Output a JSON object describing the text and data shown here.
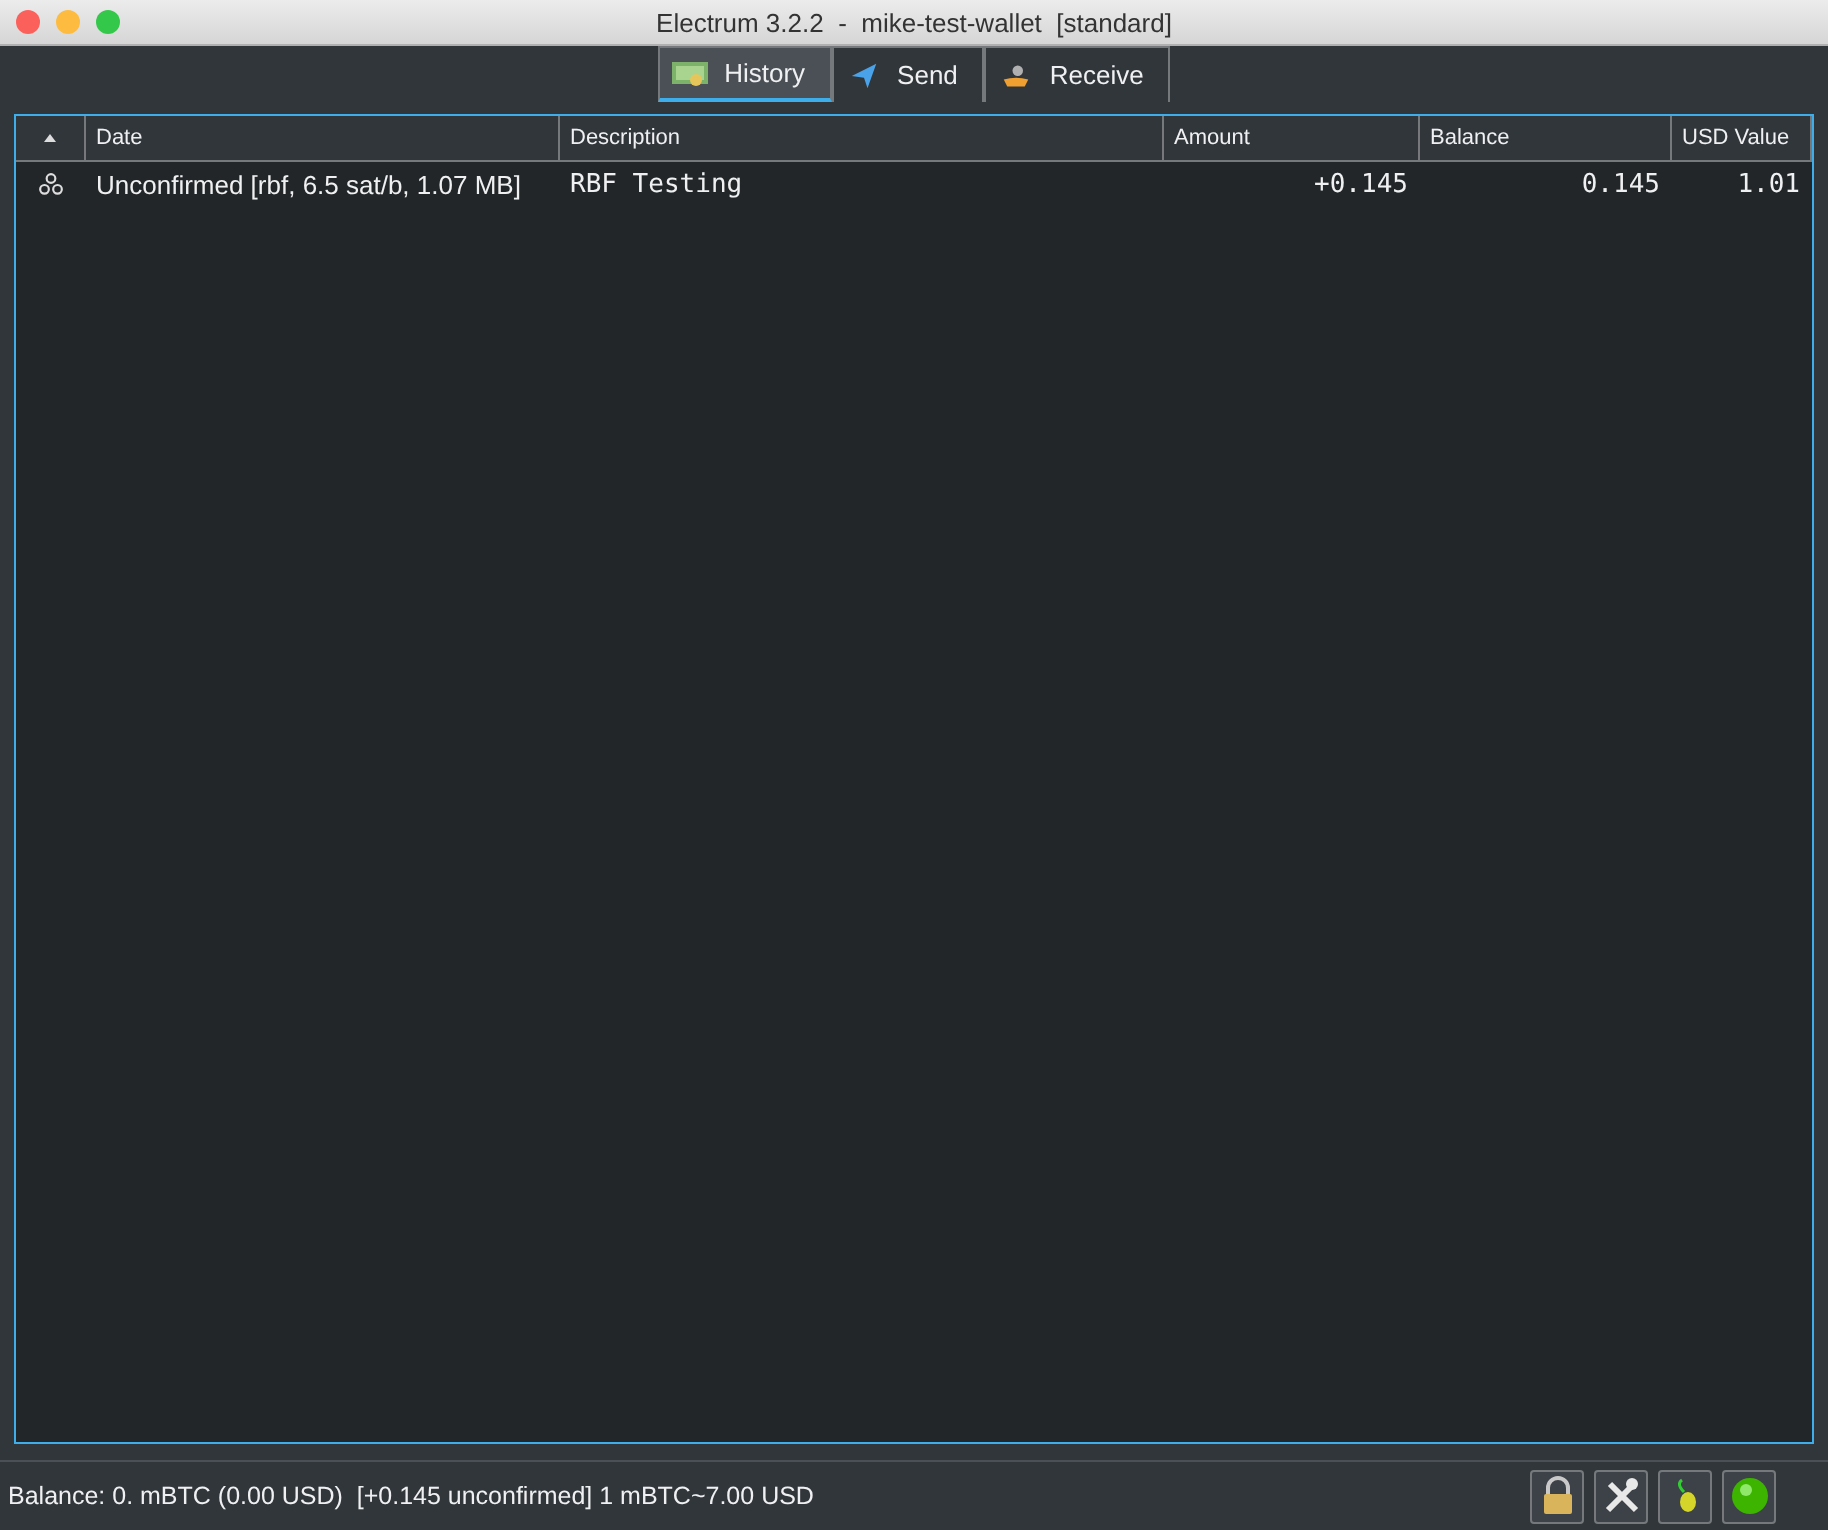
{
  "window": {
    "title": "Electrum 3.2.2  -  mike-test-wallet  [standard]"
  },
  "tabs": [
    {
      "label": "History",
      "kind": "history",
      "selected": true
    },
    {
      "label": "Send",
      "kind": "send",
      "selected": false
    },
    {
      "label": "Receive",
      "kind": "receive",
      "selected": false
    }
  ],
  "table": {
    "columns": [
      "Date",
      "Description",
      "Amount",
      "Balance",
      "USD Value"
    ],
    "rows": [
      {
        "kind": "unconfirmed",
        "date": "Unconfirmed [rbf, 6.5 sat/b, 1.07 MB]",
        "description": "RBF Testing",
        "amount": "+0.145",
        "balance": "0.145",
        "usd_value": "1.01"
      }
    ]
  },
  "status_bar": {
    "text": "Balance: 0. mBTC (0.00 USD)  [+0.145 unconfirmed] 1 mBTC~7.00 USD"
  }
}
